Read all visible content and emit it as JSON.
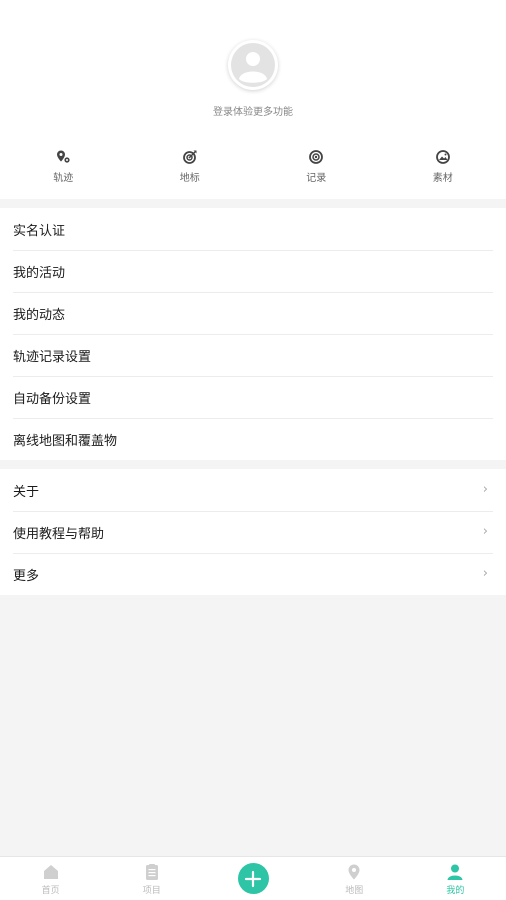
{
  "profile": {
    "login_hint": "登录体验更多功能"
  },
  "quick_actions": [
    {
      "label": "轨迹",
      "icon": "track-icon"
    },
    {
      "label": "地标",
      "icon": "landmark-icon"
    },
    {
      "label": "记录",
      "icon": "record-icon"
    },
    {
      "label": "素材",
      "icon": "material-icon"
    }
  ],
  "menu_group_1": [
    {
      "label": "实名认证"
    },
    {
      "label": "我的活动"
    },
    {
      "label": "我的动态"
    },
    {
      "label": "轨迹记录设置"
    },
    {
      "label": "自动备份设置"
    },
    {
      "label": "离线地图和覆盖物"
    }
  ],
  "menu_group_2": [
    {
      "label": "关于",
      "chevron": "›"
    },
    {
      "label": "使用教程与帮助",
      "chevron": "›"
    },
    {
      "label": "更多",
      "chevron": "›"
    }
  ],
  "tabbar": [
    {
      "label": "首页",
      "icon": "home-icon"
    },
    {
      "label": "项目",
      "icon": "project-icon"
    },
    {
      "label": "地图",
      "icon": "map-pin-icon"
    },
    {
      "label": "我的",
      "icon": "user-icon"
    }
  ],
  "colors": {
    "accent": "#2ec4a6",
    "inactive": "#bbbbbb",
    "background": "#f4f4f4"
  }
}
